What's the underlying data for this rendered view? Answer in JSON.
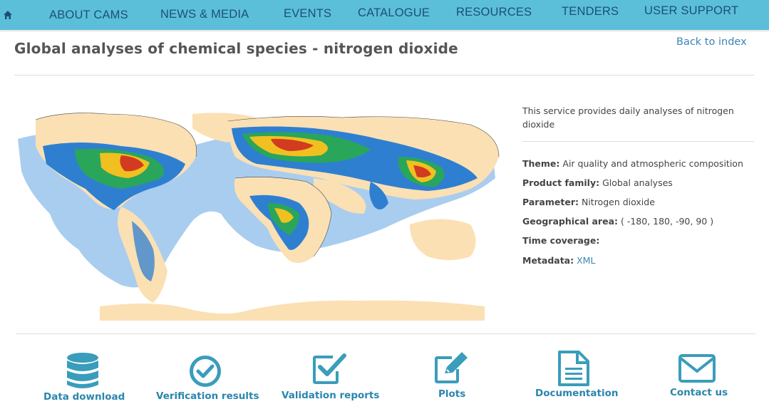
{
  "nav": {
    "home_icon": "home-icon",
    "items": [
      "ABOUT CAMS",
      "NEWS & MEDIA",
      "EVENTS",
      "CATALOGUE",
      "RESOURCES",
      "TENDERS",
      "USER SUPPORT"
    ]
  },
  "header": {
    "title": "Global analyses of chemical species - nitrogen dioxide",
    "back_link": "Back to index"
  },
  "map": {
    "description": "World map of nitrogen dioxide concentrations",
    "colors": {
      "ocean_low": "#a9cdef",
      "low": "#2f7fd0",
      "mid": "#1aa0c8",
      "medium": "#29a65a",
      "high": "#f0c020",
      "very_high": "#d23b1f",
      "land": "#fbe0b4"
    }
  },
  "info": {
    "description": "This service provides daily analyses of nitrogen dioxide",
    "theme_label": "Theme:",
    "theme_value": "Air quality and atmospheric composition",
    "family_label": "Product family:",
    "family_value": "Global analyses",
    "parameter_label": "Parameter:",
    "parameter_value": "Nitrogen dioxide",
    "area_label": "Geographical area:",
    "area_value": "( -180, 180, -90, 90 )",
    "time_label": "Time coverage:",
    "time_value": "",
    "metadata_label": "Metadata:",
    "metadata_value": "XML"
  },
  "tiles": [
    {
      "label": "Data download",
      "icon": "database-icon"
    },
    {
      "label": "Verification results",
      "icon": "check-circle-icon"
    },
    {
      "label": "Validation reports",
      "icon": "checkbox-icon"
    },
    {
      "label": "Plots",
      "icon": "edit-icon"
    },
    {
      "label": "Documentation",
      "icon": "document-icon"
    },
    {
      "label": "Contact us",
      "icon": "envelope-icon"
    }
  ],
  "colors": {
    "nav_bg": "#5bbfd9",
    "nav_text": "#1b4f7a",
    "link": "#3a84b4",
    "icon": "#3a9dbb"
  }
}
